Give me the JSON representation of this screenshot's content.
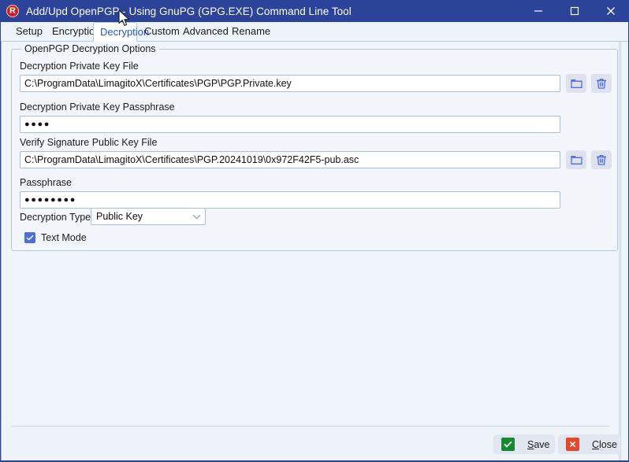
{
  "window": {
    "title": "Add/Upd OpenPGP - Using GnuPG (GPG.EXE) Command Line Tool",
    "app_icon": "r-logo-icon",
    "titlebar_color": "#2b4499",
    "controls": {
      "minimize": "minimize-icon",
      "maximize": "maximize-icon",
      "close": "close-icon"
    }
  },
  "tabs": [
    {
      "label": "Setup",
      "active": false
    },
    {
      "label": "Encryption",
      "active": false
    },
    {
      "label": "Decryption",
      "active": true
    },
    {
      "label": "Custom",
      "active": false
    },
    {
      "label": "Advanced",
      "active": false
    },
    {
      "label": "Rename",
      "active": false
    }
  ],
  "group": {
    "title": "OpenPGP Decryption Options"
  },
  "fields": {
    "private_key_file": {
      "label": "Decryption Private Key File",
      "value": "C:\\ProgramData\\LimagitoX\\Certificates\\PGP\\PGP.Private.key",
      "browse_icon": "folder-icon",
      "clear_icon": "trash-icon"
    },
    "private_key_passphrase": {
      "label": "Decryption Private Key Passphrase",
      "value": "●●●●"
    },
    "verify_public_key_file": {
      "label": "Verify Signature Public Key File",
      "value": "C:\\ProgramData\\LimagitoX\\Certificates\\PGP.20241019\\0x972F42F5-pub.asc",
      "browse_icon": "folder-icon",
      "clear_icon": "trash-icon"
    },
    "passphrase": {
      "label": "Passphrase",
      "value": "●●●●●●●●"
    },
    "decryption_type": {
      "label": "Decryption Type",
      "value": "Public Key",
      "arrow_icon": "chevron-down-icon"
    },
    "text_mode": {
      "label": "Text Mode",
      "checked": true
    }
  },
  "footer": {
    "save": {
      "label_pre": "",
      "mnemonic": "S",
      "label_post": "ave",
      "icon": "check-icon",
      "icon_color": "#17892f"
    },
    "close": {
      "label_pre": "",
      "mnemonic": "C",
      "label_post": "lose",
      "icon": "x-icon",
      "icon_color": "#e8482a"
    }
  },
  "colors": {
    "accent": "#2b4499",
    "active_tab_text": "#2558c8",
    "icon_blue": "#4f6ce0",
    "page_bg": "#f0f5fb"
  }
}
